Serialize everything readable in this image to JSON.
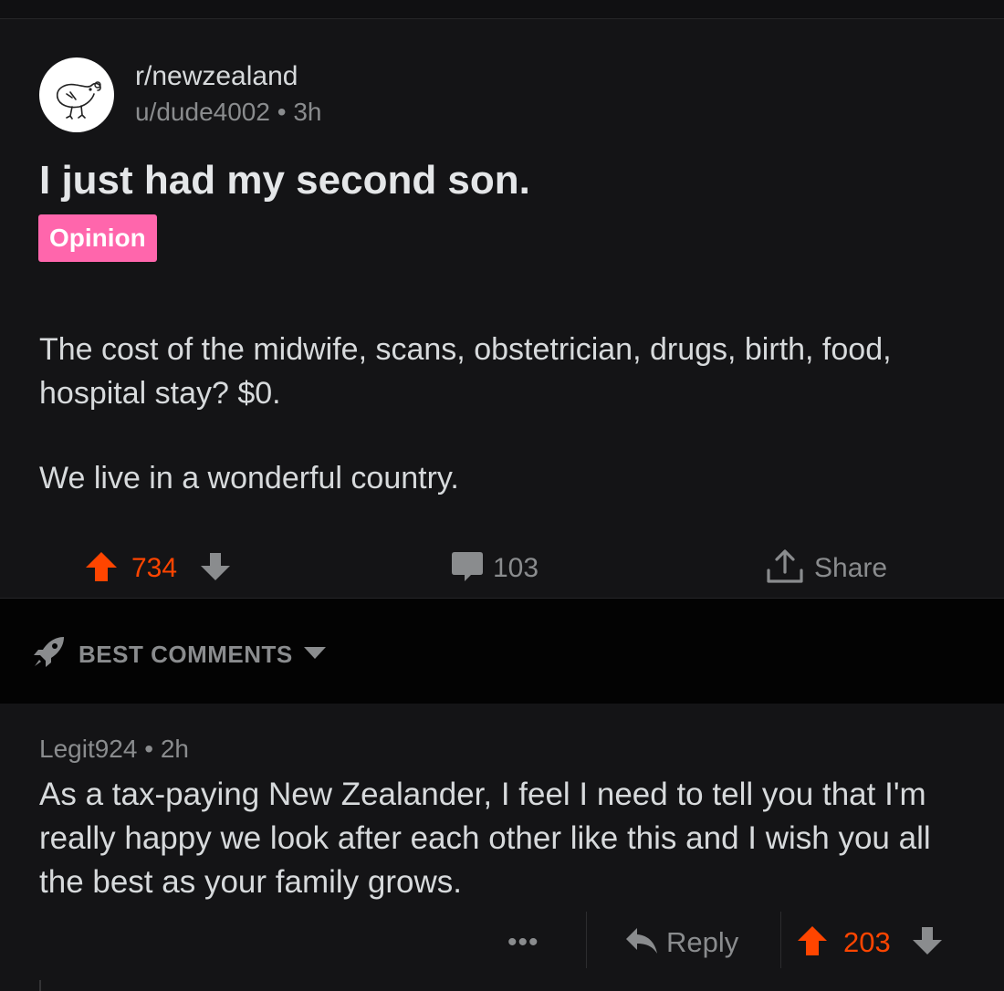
{
  "post": {
    "subreddit": "r/newzealand",
    "author": "u/dude4002",
    "separator": "•",
    "age": "3h",
    "title": "I just had my second son.",
    "flair": "Opinion",
    "body": [
      "The cost of the midwife, scans, obstetrician, drugs, birth, food, hospital stay? $0.",
      "We live in a wonderful country."
    ],
    "score": "734",
    "comment_count": "103",
    "share_label": "Share"
  },
  "sort": {
    "label": "BEST COMMENTS"
  },
  "comment": {
    "author": "Legit924",
    "separator": "•",
    "age": "2h",
    "body": "As a tax-paying New Zealander, I feel I need to tell you that I'm really happy we look after each other like this and I wish you all the best as your family grows.",
    "more": "•••",
    "reply_label": "Reply",
    "score": "203"
  },
  "colors": {
    "background": "#141416",
    "upvote": "#ff4500",
    "flair": "#ff66ac",
    "muted": "#8a8c8e"
  },
  "icons": [
    "kiwi-bird-avatar",
    "upvote-arrow",
    "downvote-arrow",
    "comment-bubble",
    "share-upload",
    "rocket",
    "caret-down",
    "reply-arrow"
  ]
}
